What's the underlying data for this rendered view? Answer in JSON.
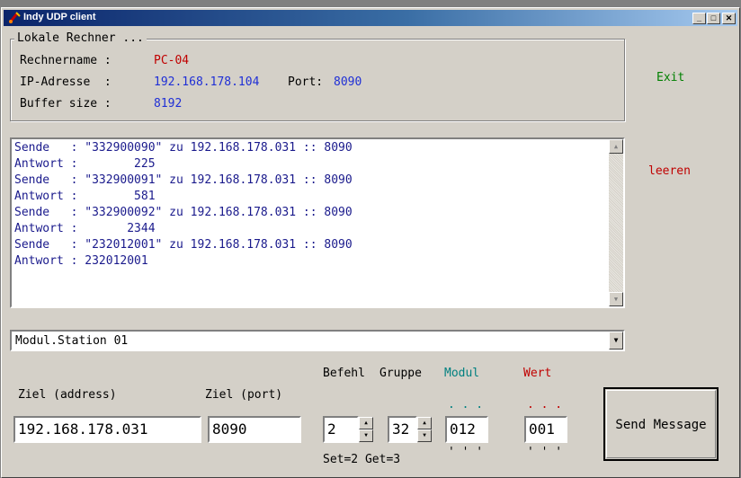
{
  "window": {
    "title": "Indy UDP client"
  },
  "local": {
    "caption": "Lokale Rechner ...",
    "name_label": "Rechnername :",
    "name_value": "PC-04",
    "ip_label": "IP-Adresse  :",
    "ip_value": "192.168.178.104",
    "port_label": "Port:",
    "port_value": "8090",
    "buffer_label": "Buffer size :",
    "buffer_value": "8192"
  },
  "actions": {
    "exit_label": "Exit",
    "clear_label": "leeren"
  },
  "log": {
    "lines": [
      "Sende   : \"332900090\" zu 192.168.178.031 :: 8090",
      "Antwort :        225",
      "Sende   : \"332900091\" zu 192.168.178.031 :: 8090",
      "Antwort :        581",
      "Sende   : \"332900092\" zu 192.168.178.031 :: 8090",
      "Antwort :       2344",
      "Sende   : \"232012001\" zu 192.168.178.031 :: 8090",
      "Antwort : 232012001"
    ]
  },
  "station": {
    "selected": "Modul.Station 01"
  },
  "target": {
    "address_label": "Ziel (address)",
    "address_value": "192.168.178.031",
    "port_label": "Ziel (port)",
    "port_value": "8090"
  },
  "command": {
    "befehl_label": "Befehl",
    "befehl_value": "2",
    "gruppe_label": "Gruppe",
    "gruppe_value": "32",
    "modul_label": "Modul",
    "modul_dots": ". . .",
    "modul_value": "012",
    "modul_ticks": "' ' '",
    "wert_label": "Wert",
    "wert_dots": ". . .",
    "wert_value": "001",
    "wert_ticks": "' ' '",
    "hint": "Set=2 Get=3",
    "send_label": "Send Message"
  }
}
